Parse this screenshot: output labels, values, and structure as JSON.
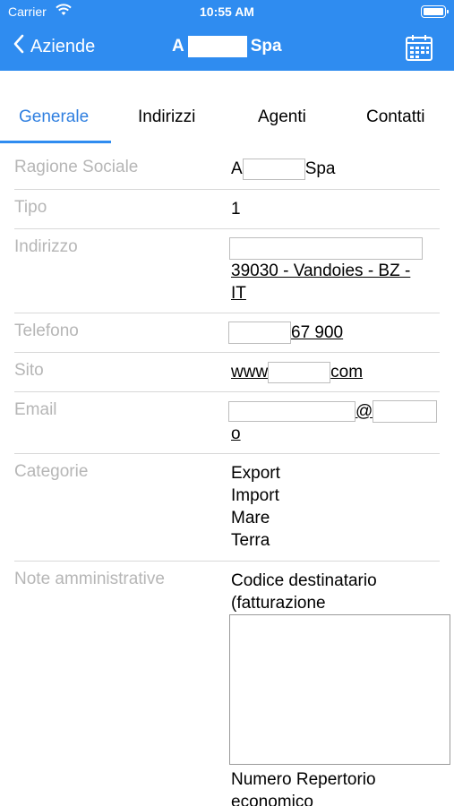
{
  "status": {
    "carrier": "Carrier",
    "time": "10:55 AM"
  },
  "nav": {
    "back_label": "Aziende",
    "title_start": "A",
    "title_end": "Spa"
  },
  "tabs": [
    "Generale",
    "Indirizzi",
    "Agenti",
    "Contatti"
  ],
  "fields": {
    "ragione_sociale": {
      "label": "Ragione Sociale",
      "start": "A",
      "end": "Spa"
    },
    "tipo": {
      "label": "Tipo",
      "value": "1"
    },
    "indirizzo": {
      "label": "Indirizzo",
      "line2": "39030 - Vandoies - BZ -",
      "line3": "IT"
    },
    "telefono": {
      "label": "Telefono",
      "value": "67 900"
    },
    "sito": {
      "label": "Sito",
      "start": "www",
      "end": "com"
    },
    "email": {
      "label": "Email",
      "at": "@",
      "end": "o"
    },
    "categorie": {
      "label": "Categorie",
      "items": [
        "Export",
        "Import",
        "Mare",
        "Terra"
      ]
    },
    "note": {
      "label": "Note amministrative",
      "line1": "Codice destinatario",
      "line2": "(fatturazione",
      "line3": "Numero Repertorio",
      "line4": "economico"
    }
  },
  "colors": {
    "accent": "#2f8cf0",
    "label": "#b6b6b6",
    "separator": "#d8d8d8"
  },
  "icons": [
    "wifi-icon",
    "battery-icon",
    "chevron-left-icon",
    "calendar-icon"
  ]
}
